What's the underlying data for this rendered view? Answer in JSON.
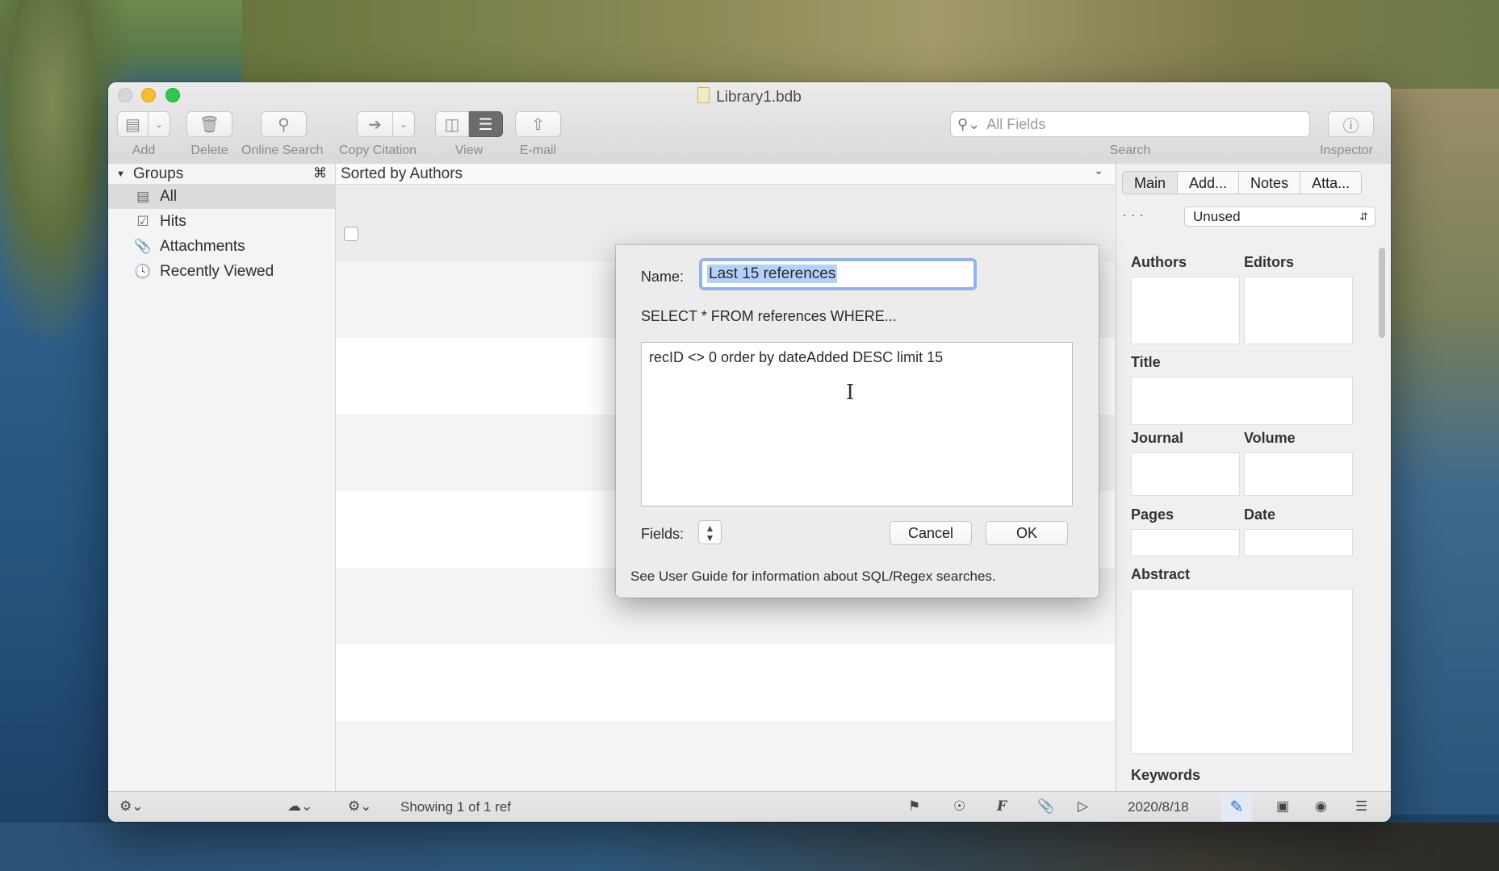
{
  "window": {
    "title": "Library1.bdb"
  },
  "toolbar": {
    "add": "Add",
    "delete": "Delete",
    "online_search": "Online Search",
    "copy_citation": "Copy Citation",
    "view": "View",
    "email": "E-mail",
    "search_placeholder": "All Fields",
    "search_label": "Search",
    "inspector": "Inspector"
  },
  "sidebar": {
    "header": "Groups",
    "header_shortcut": "⌘",
    "items": [
      {
        "label": "All",
        "icon": "library-icon",
        "selected": true
      },
      {
        "label": "Hits",
        "icon": "checkbox-icon"
      },
      {
        "label": "Attachments",
        "icon": "paperclip-icon"
      },
      {
        "label": "Recently Viewed",
        "icon": "clock-icon"
      }
    ]
  },
  "list": {
    "sort_label": "Sorted by Authors"
  },
  "inspector": {
    "tabs": [
      "Main",
      "Add...",
      "Notes",
      "Atta..."
    ],
    "dots": "...",
    "type_select": "Unused",
    "fields": {
      "authors": "Authors",
      "editors": "Editors",
      "title": "Title",
      "journal": "Journal",
      "volume": "Volume",
      "pages": "Pages",
      "date": "Date",
      "abstract": "Abstract",
      "keywords": "Keywords"
    }
  },
  "dialog": {
    "name_label": "Name:",
    "name_value": "Last 15 references",
    "select_text": "SELECT * FROM references WHERE...",
    "query": "recID <> 0 order by dateAdded DESC limit 15",
    "fields_label": "Fields:",
    "cancel": "Cancel",
    "ok": "OK",
    "note": "See User Guide for information about SQL/Regex searches."
  },
  "statusbar": {
    "showing": "Showing 1 of 1 ref",
    "date": "2020/8/18"
  },
  "colors": {
    "accent": "#2b6fe0",
    "selection": "#b4d1fb",
    "focus_ring": "#8fb3f2"
  }
}
